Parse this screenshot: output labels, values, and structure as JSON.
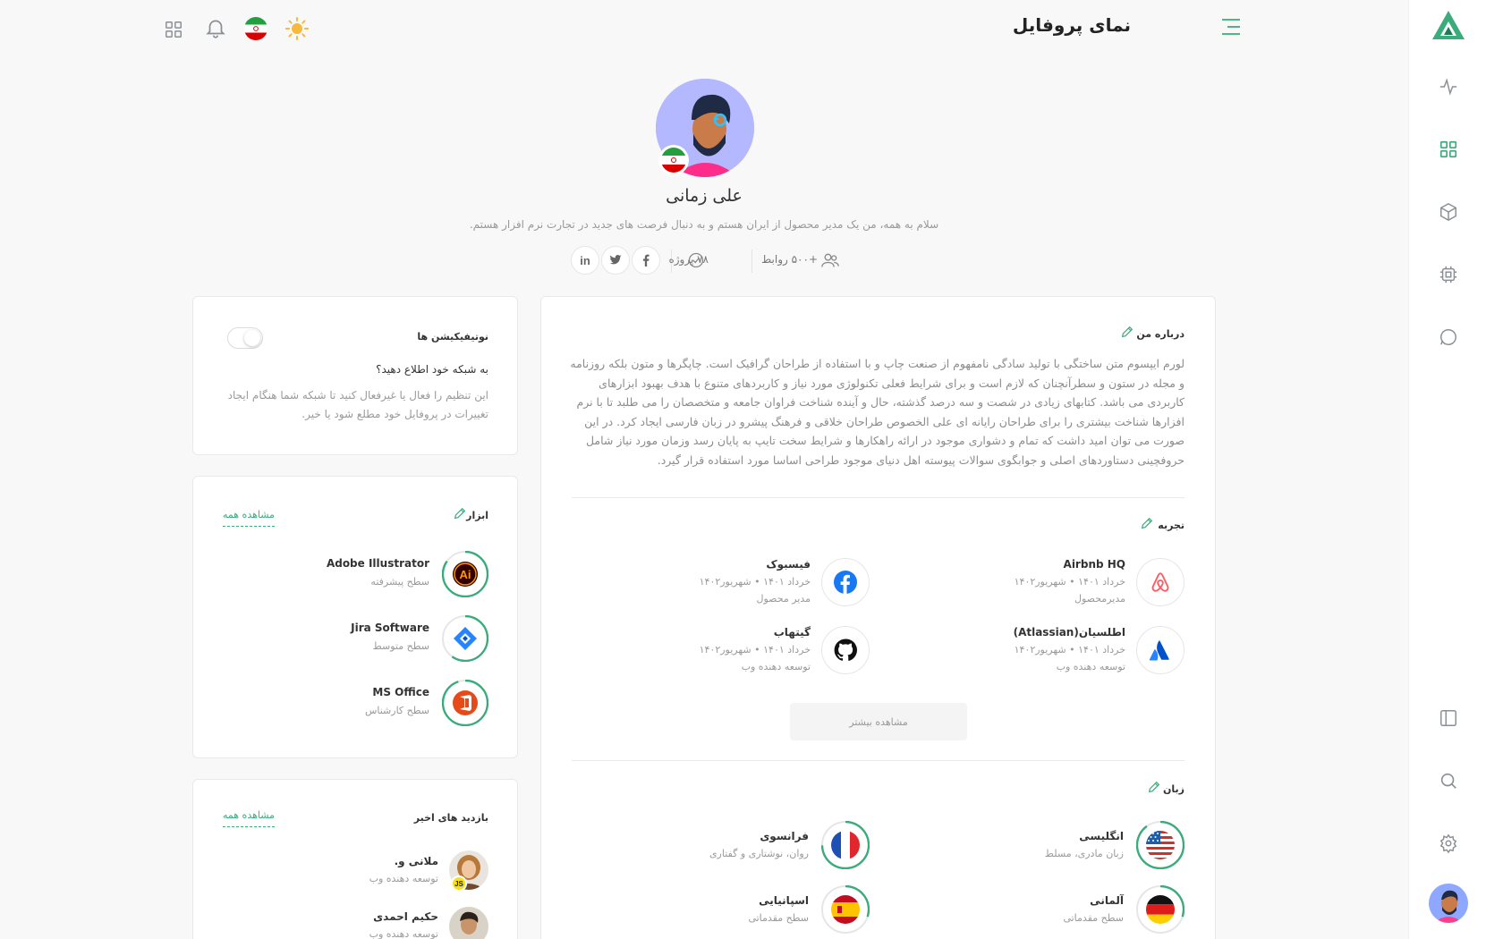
{
  "header": {
    "title": "نمای پروفایل"
  },
  "profile": {
    "name": "علی زمانی",
    "bio": "سلام به همه، من یک مدیر محصول از ایران هستم و به دنبال فرصت های جدید در تجارت نرم افزار هستم.",
    "connections": "+۵۰۰ روابط",
    "projects": "۷۸ پروژه",
    "social": [
      "linkedin-icon",
      "twitter-icon",
      "facebook-icon"
    ]
  },
  "notifications": {
    "title": "نوتیفیکیشن ها",
    "question": "به شبکه خود اطلاع دهید؟",
    "description": "این تنظیم را فعال یا غیرفعال کنید تا شبکه شما هنگام ایجاد تغییرات در پروفایل خود مطلع شود یا خیر.",
    "enabled": false
  },
  "tools": {
    "title": "ابزار",
    "view_all": "مشاهده همه",
    "items": [
      {
        "name": "Adobe Illustrator",
        "level": "سطح پیشرفته",
        "progress": 0.85,
        "icon": "illustrator-icon"
      },
      {
        "name": "Jira Software",
        "level": "سطح متوسط",
        "progress": 0.6,
        "icon": "jira-icon"
      },
      {
        "name": "MS Office",
        "level": "سطح کارشناس",
        "progress": 0.95,
        "icon": "office-icon"
      }
    ]
  },
  "visits": {
    "title": "بازدید های اخیر",
    "view_all": "مشاهده همه",
    "items": [
      {
        "name": "ملانی و.",
        "role": "توسعه دهنده وب",
        "badge": "JS"
      },
      {
        "name": "حکیم احمدی",
        "role": "توسعه دهنده وب"
      }
    ]
  },
  "about": {
    "title": "درباره من",
    "text": "لورم ایپسوم متن ساختگی با تولید سادگی نامفهوم از صنعت چاپ و با استفاده از طراحان گرافیک است. چاپگرها و متون بلکه روزنامه و مجله در ستون و سطرآنچنان که لازم است و برای شرایط فعلی تکنولوژی مورد نیاز و کاربردهای متنوع با هدف بهبود ابزارهای کاربردی می باشد. کتابهای زیادی در شصت و سه درصد گذشته، حال و آینده شناخت فراوان جامعه و متخصصان را می طلبد تا با نرم افزارها شناخت بیشتری را برای طراحان رایانه ای علی الخصوص طراحان خلاقی و فرهنگ پیشرو در زبان فارسی ایجاد کرد. در این صورت می توان امید داشت که تمام و دشواری موجود در ارائه راهکارها و شرایط سخت تایپ به پایان رسد وزمان مورد نیاز شامل حروفچینی دستاوردهای اصلی و جوابگوی سوالات پیوسته اهل دنیای موجود طراحی اساسا مورد استفاده قرار گیرد."
  },
  "experience": {
    "title": "تجربه",
    "more_label": "مشاهده بیشتر",
    "items": [
      {
        "company": "Airbnb HQ",
        "dates": "خرداد ۱۴۰۱ • شهریور۱۴۰۲",
        "role": "مدیرمحصول",
        "icon": "airbnb-icon"
      },
      {
        "company": "فیسبوک",
        "dates": "خرداد ۱۴۰۱ • شهریور۱۴۰۲",
        "role": "مدیر محصول",
        "icon": "facebook-icon"
      },
      {
        "company": "اطلسیان(Atlassian)",
        "dates": "خرداد ۱۴۰۱ • شهریور۱۴۰۲",
        "role": "توسعه دهنده وب",
        "icon": "atlassian-icon"
      },
      {
        "company": "گیتهاب",
        "dates": "خرداد ۱۴۰۱ • شهریور۱۴۰۲",
        "role": "توسعه دهنده وب",
        "icon": "github-icon"
      }
    ]
  },
  "languages": {
    "title": "زبان",
    "items": [
      {
        "name": "انگلیسی",
        "level": "زبان مادری، مسلط",
        "progress": 0.9,
        "icon": "us-flag-icon"
      },
      {
        "name": "فرانسوی",
        "level": "روان، نوشتاری و گفتاری",
        "progress": 0.75,
        "icon": "france-flag-icon"
      },
      {
        "name": "آلمانی",
        "level": "سطح مقدماتی",
        "progress": 0.3,
        "icon": "germany-flag-icon"
      },
      {
        "name": "اسپانیایی",
        "level": "سطح مقدماتی",
        "progress": 0.3,
        "icon": "spain-flag-icon"
      }
    ]
  },
  "colors": {
    "accent": "#3aab7b",
    "background": "#f8f8f8",
    "card": "#ffffff"
  }
}
